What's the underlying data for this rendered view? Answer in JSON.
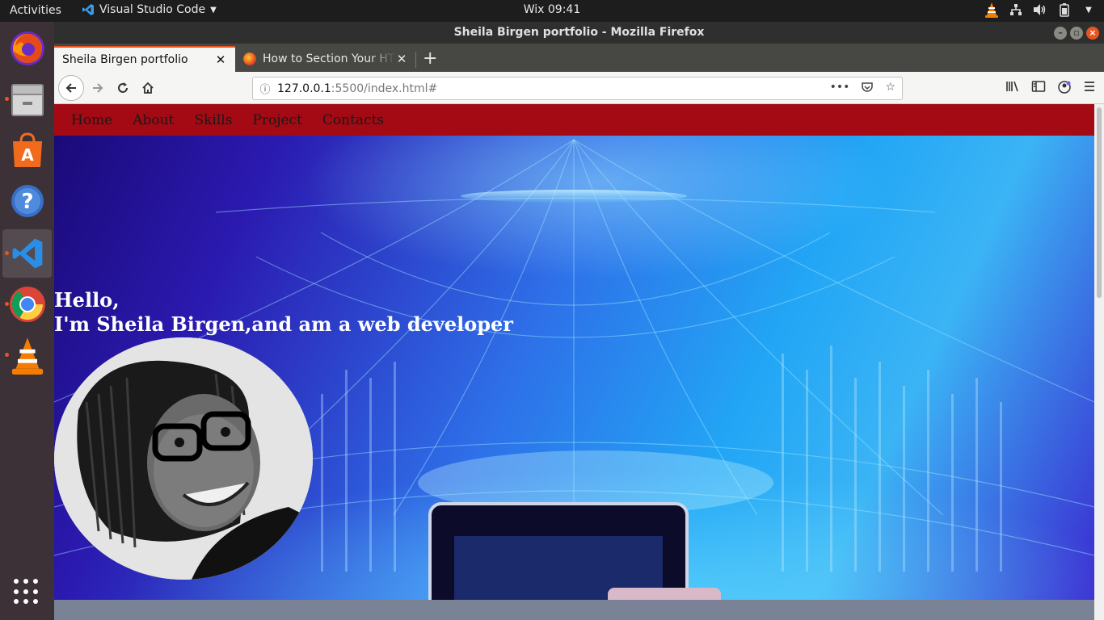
{
  "topbar": {
    "activities": "Activities",
    "app_name": "Visual Studio Code",
    "clock": "Wix 09:41"
  },
  "dock": {
    "items": [
      {
        "name": "firefox"
      },
      {
        "name": "files"
      },
      {
        "name": "software-center"
      },
      {
        "name": "help"
      },
      {
        "name": "vscode"
      },
      {
        "name": "chrome"
      },
      {
        "name": "vlc"
      }
    ]
  },
  "window": {
    "title": "Sheila Birgen portfolio - Mozilla Firefox"
  },
  "tabs": [
    {
      "label": "Sheila Birgen portfolio"
    },
    {
      "label": "How to Section Your HTML"
    }
  ],
  "url": {
    "host": "127.0.0.1",
    "path": ":5500/index.html#"
  },
  "site": {
    "nav": [
      "Home",
      "About",
      "Skills",
      "Project",
      "Contacts"
    ],
    "greeting_line1": "Hello,",
    "greeting_line2": "I'm Sheila Birgen,and am a web developer"
  },
  "colors": {
    "nav_bg": "#a30a14",
    "accent": "#e95420"
  }
}
